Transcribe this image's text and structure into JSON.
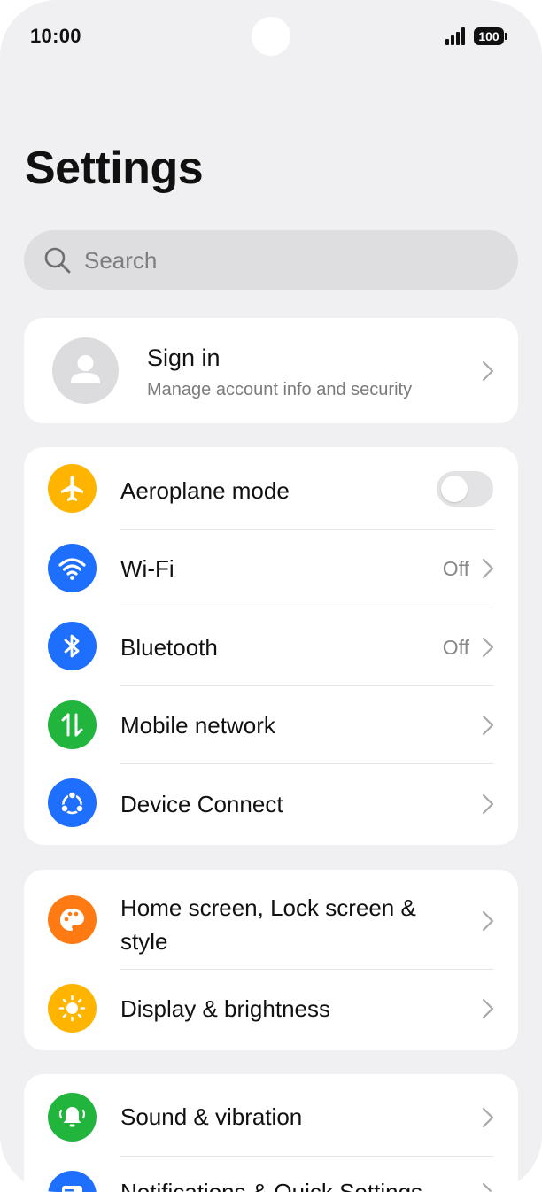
{
  "status_bar": {
    "time": "10:00",
    "battery": "100"
  },
  "page": {
    "title": "Settings"
  },
  "search": {
    "placeholder": "Search"
  },
  "account": {
    "title": "Sign in",
    "subtitle": "Manage account info and security"
  },
  "connectivity": {
    "items": [
      {
        "label": "Aeroplane mode",
        "icon": "airplane-icon",
        "color": "#FFB400",
        "toggle_on": false
      },
      {
        "label": "Wi-Fi",
        "value": "Off",
        "icon": "wifi-icon",
        "color": "#1F6FFF"
      },
      {
        "label": "Bluetooth",
        "value": "Off",
        "icon": "bluetooth-icon",
        "color": "#1F6FFF"
      },
      {
        "label": "Mobile network",
        "icon": "mobile-data-icon",
        "color": "#22B53D"
      },
      {
        "label": "Device Connect",
        "icon": "device-connect-icon",
        "color": "#1F6FFF"
      }
    ]
  },
  "personalization": {
    "items": [
      {
        "label_line1": "Home screen, Lock screen &",
        "label_line2": "style",
        "icon": "palette-icon",
        "color": "#FF7A12"
      },
      {
        "label": "Display & brightness",
        "icon": "sun-icon",
        "color": "#FFB400"
      }
    ]
  },
  "sound": {
    "items": [
      {
        "label": "Sound & vibration",
        "icon": "bell-icon",
        "color": "#22B53D"
      },
      {
        "label": "Notifications & Quick Settings",
        "icon": "notification-icon",
        "color": "#1F6FFF"
      }
    ]
  }
}
